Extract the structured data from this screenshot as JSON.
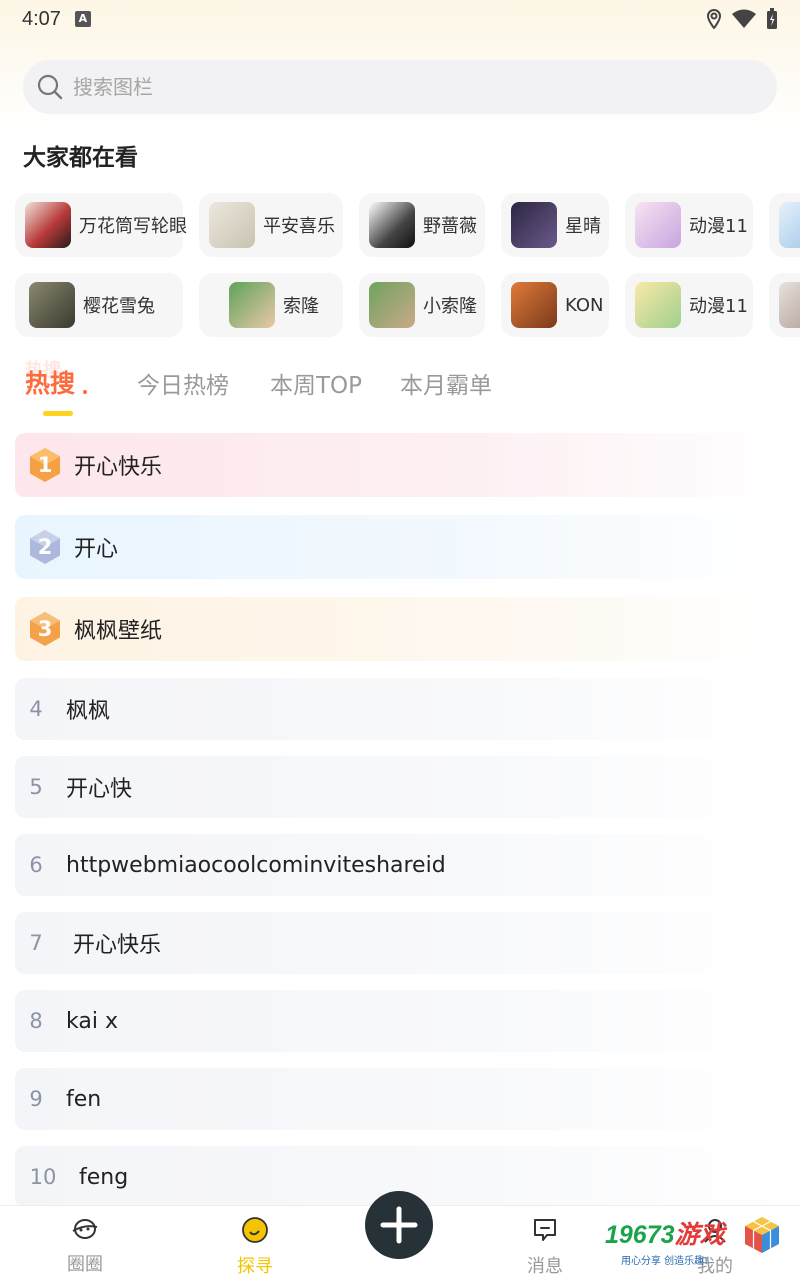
{
  "status": {
    "time": "4:07",
    "a_badge": "A"
  },
  "search": {
    "placeholder": "搜索图栏"
  },
  "section_title": "大家都在看",
  "chips_row1": [
    {
      "label": "万花筒写轮眼",
      "thumb_color": "#b83a3a"
    },
    {
      "label": "平安喜乐",
      "thumb_color": "#d8d3c4"
    },
    {
      "label": "野蔷薇",
      "thumb_color": "#3a3a3a"
    },
    {
      "label": "星晴",
      "thumb_color": "#4b3e6b"
    },
    {
      "label": "动漫11",
      "thumb_color": "#e8b4d8"
    },
    {
      "label": "",
      "thumb_color": "#b8d4ee"
    }
  ],
  "chips_row2": [
    {
      "label": "樱花雪兔",
      "thumb_color": "#6b6a55"
    },
    {
      "label": "索隆",
      "thumb_color": "#4f8a4a"
    },
    {
      "label": "小索隆",
      "thumb_color": "#a98c6a"
    },
    {
      "label": "KON",
      "thumb_color": "#c76a3a"
    },
    {
      "label": "动漫11",
      "thumb_color": "#f2d36b"
    },
    {
      "label": "",
      "thumb_color": "#cfc6c0"
    }
  ],
  "tabs": {
    "hot": "热搜",
    "hot_shadow": "热搜",
    "today": "今日热榜",
    "week": "本周TOP",
    "month": "本月霸单"
  },
  "ranks": [
    {
      "num": "1",
      "title": "开心快乐",
      "bg_from": "#fde6ec",
      "badge_color": "#f7a043"
    },
    {
      "num": "2",
      "title": "开心",
      "bg_from": "#e9f5fe",
      "badge_color": "#aeb8dc"
    },
    {
      "num": "3",
      "title": "枫枫壁纸",
      "bg_from": "#fef3e3",
      "badge_color": "#f3a24a"
    },
    {
      "num": "4",
      "title": "枫枫"
    },
    {
      "num": "5",
      "title": "开心快"
    },
    {
      "num": "6",
      "title": "httpwebmiaocoolcominviteshareid"
    },
    {
      "num": "7",
      "title": " 开心快乐"
    },
    {
      "num": "8",
      "title": "kai x"
    },
    {
      "num": "9",
      "title": "fen"
    },
    {
      "num": "10",
      "title": "feng"
    }
  ],
  "nav": {
    "circle": "圈圈",
    "explore": "探寻",
    "messages": "消息",
    "mine": "我的"
  },
  "watermark": {
    "brand_digits": "19673",
    "brand_cn": "游戏",
    "slogan": "用心分享  创造乐趣!"
  },
  "colors": {
    "accent_yellow": "#f5c400",
    "tab_active": "#ff6a3d",
    "fab": "#263238"
  }
}
